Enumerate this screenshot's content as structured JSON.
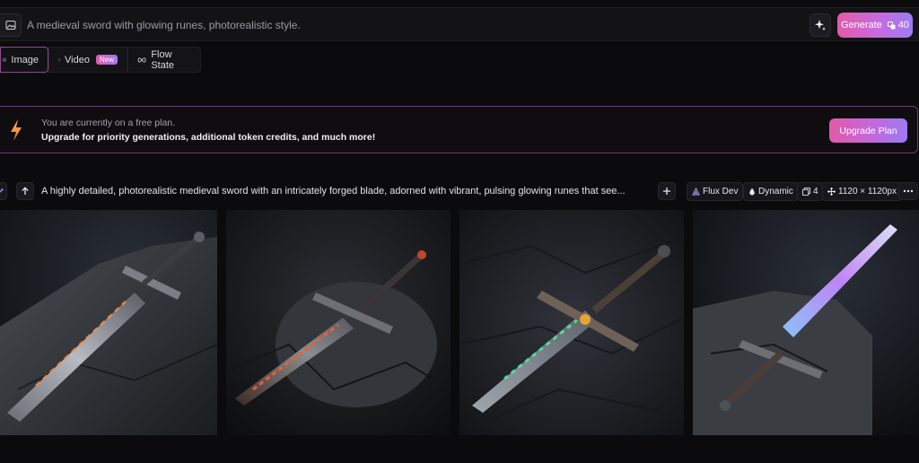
{
  "prompt_bar": {
    "prompt": "A medieval sword with glowing runes, photorealistic style.",
    "generate_label": "Generate",
    "token_cost": "40"
  },
  "tabs": [
    {
      "label": "Image"
    },
    {
      "label": "Video",
      "badge": "New"
    },
    {
      "label": "Flow State"
    }
  ],
  "banner": {
    "line1": "You are currently on a free plan.",
    "line2": "Upgrade for priority generations, additional token credits, and much more!",
    "button": "Upgrade Plan"
  },
  "generation": {
    "prompt": "A highly detailed, photorealistic medieval sword with an intricately forged blade, adorned with vibrant, pulsing glowing runes that see...",
    "model": "Flux Dev",
    "style": "Dynamic",
    "count": "4",
    "size": "1120 × 1120px"
  },
  "images": [
    {
      "alt": "sword-image-1"
    },
    {
      "alt": "sword-image-2"
    },
    {
      "alt": "sword-image-3"
    },
    {
      "alt": "sword-image-4"
    }
  ]
}
